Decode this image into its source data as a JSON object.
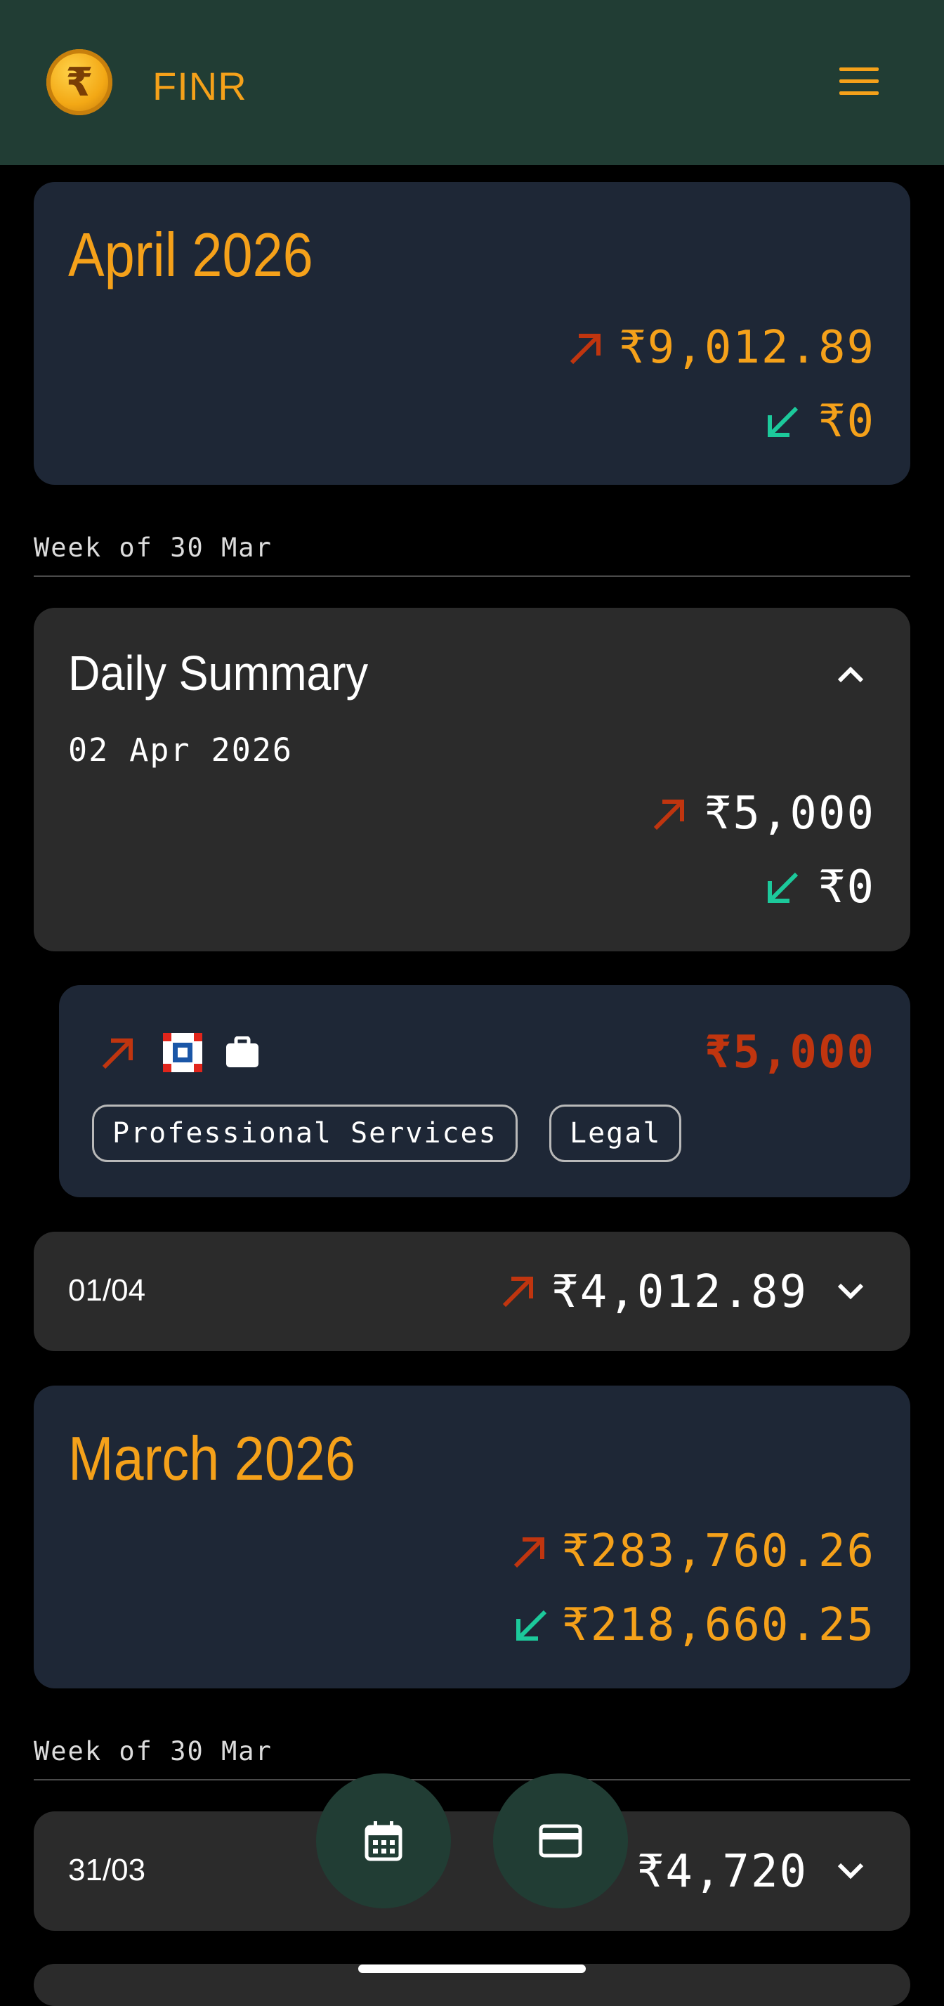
{
  "app": {
    "name": "FINR",
    "logo_symbol": "₹",
    "menu_icon": "hamburger-menu-icon"
  },
  "colors": {
    "header": "#213d34",
    "accent": "#f5a11a",
    "debit": "#c0350f",
    "credit": "#1cc99b",
    "navy_card": "#1e2736",
    "gray_card": "#2b2b2b"
  },
  "april": {
    "title": "April 2026",
    "debit": "₹9,012.89",
    "credit": "₹0"
  },
  "april_week": {
    "label": "Week of 30 Mar"
  },
  "daily_summary": {
    "title": "Daily Summary",
    "date": "02 Apr 2026",
    "debit": "₹5,000",
    "credit": "₹0"
  },
  "transaction": {
    "amount": "₹5,000",
    "tags": [
      "Professional Services",
      "Legal"
    ],
    "icons": [
      "debit-arrow-icon",
      "bank-logo-icon",
      "briefcase-icon"
    ]
  },
  "day_0104": {
    "date": "01/04",
    "amount": "₹4,012.89"
  },
  "march": {
    "title": "March 2026",
    "debit": "₹283,760.26",
    "credit": "₹218,660.25"
  },
  "march_week": {
    "label": "Week of 30 Mar"
  },
  "day_3103": {
    "date": "31/03",
    "amount": "₹4,720"
  },
  "fabs": [
    {
      "icon": "calendar-icon"
    },
    {
      "icon": "credit-card-icon"
    }
  ]
}
